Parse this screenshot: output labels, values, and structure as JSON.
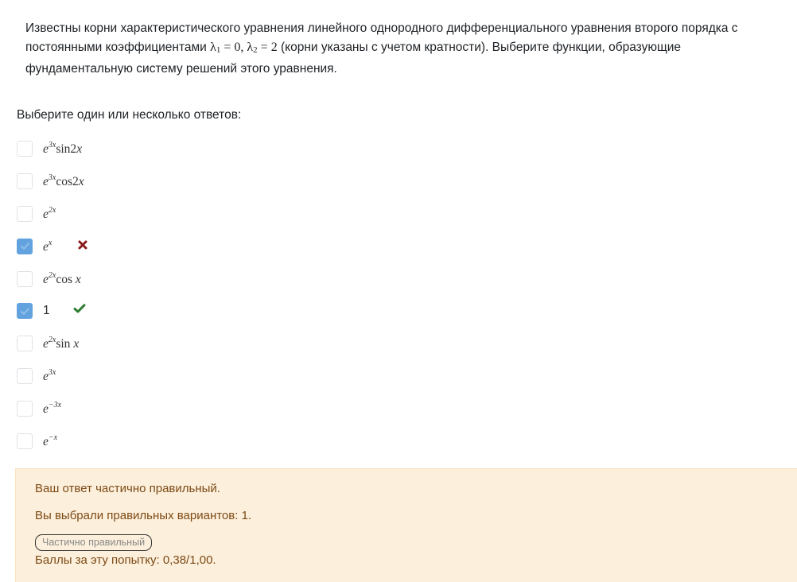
{
  "question": {
    "text_part1": "Известны корни характеристического уравнения линейного однородного дифференциального уравнения второго порядка с постоянными коэффициентами ",
    "roots_math": "λ₁ = 0, λ₂ = 2",
    "text_part2": " (корни указаны с учетом кратности). Выберите функции, образующие фундаментальную систему решений этого уравнения."
  },
  "prompt": "Выберите один или несколько ответов:",
  "answers": [
    {
      "base": "e",
      "exp": "3x",
      "rest": "sin2",
      "var": "x",
      "checked": false,
      "mark": ""
    },
    {
      "base": "e",
      "exp": "3x",
      "rest": "cos2",
      "var": "x",
      "checked": false,
      "mark": ""
    },
    {
      "base": "e",
      "exp": "2x",
      "rest": "",
      "var": "",
      "checked": false,
      "mark": ""
    },
    {
      "base": "e",
      "exp": "x",
      "rest": "",
      "var": "",
      "checked": true,
      "mark": "incorrect"
    },
    {
      "base": "e",
      "exp": "2x",
      "rest": "cos ",
      "var": "x",
      "checked": false,
      "mark": ""
    },
    {
      "text": "1",
      "checked": true,
      "mark": "correct"
    },
    {
      "base": "e",
      "exp": "2x",
      "rest": "sin ",
      "var": "x",
      "checked": false,
      "mark": ""
    },
    {
      "base": "e",
      "exp": "3x",
      "rest": "",
      "var": "",
      "checked": false,
      "mark": ""
    },
    {
      "base": "e",
      "exp": "−3x",
      "rest": "",
      "var": "",
      "checked": false,
      "mark": ""
    },
    {
      "base": "e",
      "exp": "−x",
      "rest": "",
      "var": "",
      "checked": false,
      "mark": ""
    }
  ],
  "feedback": {
    "status": "Ваш ответ частично правильный.",
    "detail": "Вы выбрали правильных вариантов: 1.",
    "badge": "Частично правильный",
    "score": "Баллы за эту попытку: 0,38/1,00."
  },
  "colors": {
    "checkbox_checked": "#62a3df",
    "incorrect": "#8b1a1a",
    "correct": "#2f7d32",
    "feedback_bg": "#fcefdc",
    "feedback_text": "#7d4a14"
  }
}
